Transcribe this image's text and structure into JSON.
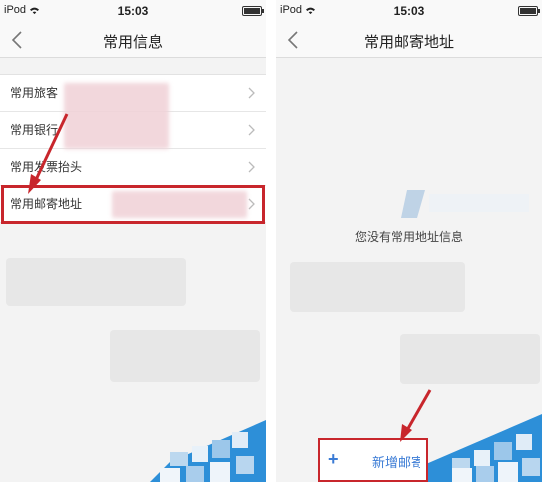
{
  "left": {
    "status": {
      "carrier": "iPod",
      "time": "15:03"
    },
    "nav": {
      "title": "常用信息"
    },
    "rows": [
      {
        "label": "常用旅客"
      },
      {
        "label": "常用银行"
      },
      {
        "label": "常用发票抬头"
      },
      {
        "label": "常用邮寄地址"
      }
    ]
  },
  "right": {
    "status": {
      "carrier": "iPod",
      "time": "15:03"
    },
    "nav": {
      "title": "常用邮寄地址"
    },
    "empty_message": "您没有常用地址信息",
    "add_button": {
      "plus": "+",
      "label": "新增邮寄地址"
    }
  },
  "colors": {
    "highlight": "#c8262c",
    "accent": "#3a7bd5",
    "watermark": "#2d8fd8"
  },
  "icons": [
    "wifi-icon",
    "battery-icon",
    "back-arrow-icon",
    "chevron-right-icon",
    "plus-icon"
  ]
}
